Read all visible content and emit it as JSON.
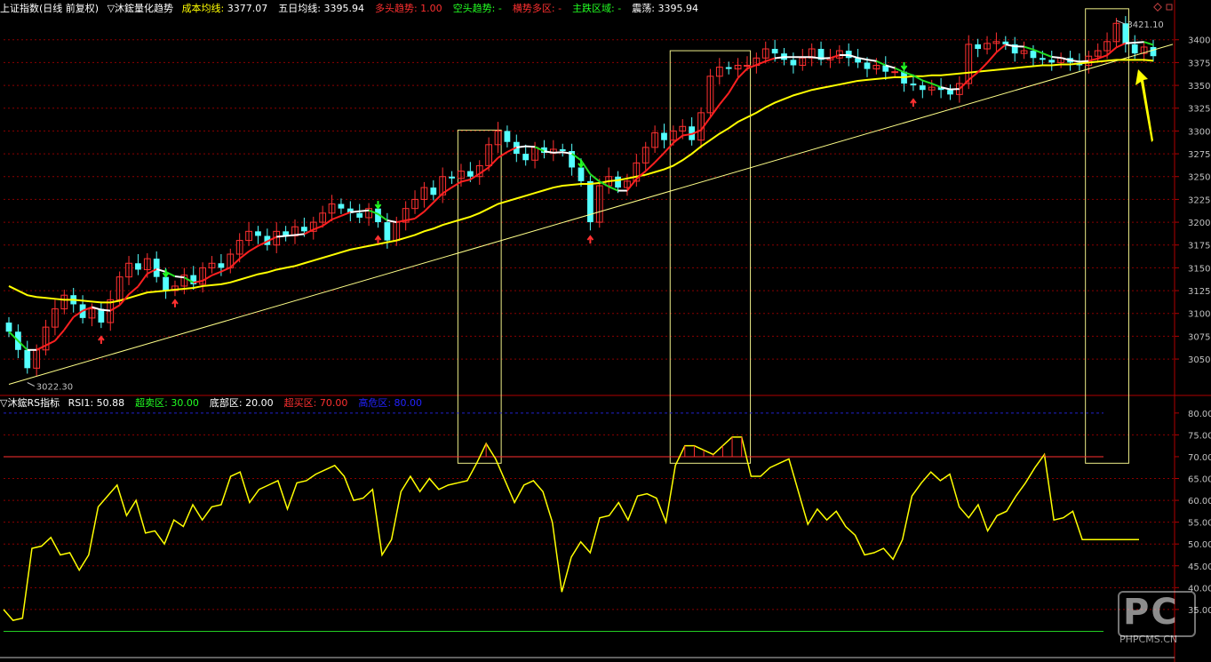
{
  "header": {
    "title": "上证指数(日线 前复权)",
    "indicator_name": "▽沐鋐量化趋势",
    "items": [
      {
        "label": "成本均线:",
        "value": "3377.07",
        "color": "#ffff00"
      },
      {
        "label": "五日均线:",
        "value": "3395.94",
        "color": "#ffffff"
      },
      {
        "label": "多头趋势:",
        "value": "1.00",
        "color": "#ff3030"
      },
      {
        "label": "空头趋势:",
        "value": "-",
        "color": "#22ff22"
      },
      {
        "label": "横势多区:",
        "value": "-",
        "color": "#ff3030"
      },
      {
        "label": "主跌区域:",
        "value": "-",
        "color": "#22ff22"
      },
      {
        "label": "震荡:",
        "value": "3395.94",
        "color": "#ffffff"
      }
    ]
  },
  "rsi_header": {
    "name": "▽沐鋐RS指标",
    "items": [
      {
        "label": "RSI1:",
        "value": "50.88",
        "color": "#ffffff"
      },
      {
        "label": "超卖区:",
        "value": "30.00",
        "color": "#22ff22"
      },
      {
        "label": "底部区:",
        "value": "20.00",
        "color": "#ffffff"
      },
      {
        "label": "超买区:",
        "value": "70.00",
        "color": "#ff3030"
      },
      {
        "label": "高危区:",
        "value": "80.00",
        "color": "#2222ff"
      }
    ]
  },
  "annotations": {
    "high_label": "3421.10",
    "low_label": "3022.30"
  },
  "watermark": {
    "logo": "PC",
    "text": "PHPCMS.CN"
  },
  "colors": {
    "up": "#ff3030",
    "down": "#54ffff",
    "cost_ma": "#ffff00",
    "ma5": "#ffffff",
    "rsi": "#ffff00",
    "grid": "#8b0000",
    "axis_text": "#c0c0c0"
  },
  "chart_data": [
    {
      "type": "candlestick",
      "title": "上证指数(日线 前复权)",
      "y_ticks": [
        3050,
        3075,
        3100,
        3125,
        3150,
        3175,
        3200,
        3225,
        3250,
        3275,
        3300,
        3325,
        3350,
        3375,
        3400
      ],
      "ylim": [
        3015,
        3428
      ],
      "close": [
        3080,
        3060,
        3040,
        3060,
        3085,
        3105,
        3120,
        3110,
        3095,
        3105,
        3090,
        3115,
        3140,
        3155,
        3148,
        3160,
        3140,
        3125,
        3130,
        3142,
        3132,
        3150,
        3155,
        3150,
        3165,
        3180,
        3190,
        3185,
        3175,
        3190,
        3185,
        3195,
        3190,
        3200,
        3210,
        3220,
        3215,
        3210,
        3205,
        3215,
        3200,
        3180,
        3200,
        3215,
        3225,
        3238,
        3230,
        3250,
        3248,
        3256,
        3250,
        3262,
        3285,
        3300,
        3288,
        3275,
        3268,
        3282,
        3276,
        3280,
        3278,
        3260,
        3245,
        3200,
        3240,
        3250,
        3238,
        3245,
        3265,
        3282,
        3298,
        3290,
        3300,
        3305,
        3290,
        3320,
        3360,
        3370,
        3368,
        3372,
        3372,
        3380,
        3390,
        3385,
        3378,
        3372,
        3380,
        3390,
        3378,
        3380,
        3388,
        3380,
        3375,
        3368,
        3372,
        3365,
        3365,
        3352,
        3350,
        3345,
        3348,
        3345,
        3340,
        3352,
        3395,
        3390,
        3396,
        3398,
        3395,
        3385,
        3388,
        3380,
        3378,
        3375,
        3380,
        3375,
        3372,
        3382,
        3388,
        3398,
        3418,
        3395,
        3385,
        3392,
        3382
      ],
      "open_ma_note": "",
      "cost_ma": [
        3130,
        3125,
        3120,
        3118,
        3117,
        3116,
        3115,
        3115,
        3114,
        3113,
        3112,
        3112,
        3114,
        3117,
        3120,
        3123,
        3124,
        3125,
        3126,
        3127,
        3128,
        3130,
        3131,
        3132,
        3134,
        3137,
        3140,
        3143,
        3145,
        3148,
        3150,
        3152,
        3155,
        3158,
        3161,
        3164,
        3167,
        3170,
        3172,
        3174,
        3176,
        3178,
        3180,
        3183,
        3186,
        3190,
        3193,
        3197,
        3200,
        3203,
        3206,
        3210,
        3215,
        3220,
        3223,
        3226,
        3229,
        3232,
        3235,
        3238,
        3240,
        3241,
        3242,
        3242,
        3243,
        3245,
        3246,
        3248,
        3250,
        3252,
        3255,
        3258,
        3262,
        3268,
        3275,
        3283,
        3290,
        3297,
        3303,
        3310,
        3315,
        3320,
        3326,
        3331,
        3335,
        3339,
        3342,
        3345,
        3347,
        3349,
        3351,
        3353,
        3355,
        3356,
        3357,
        3358,
        3359,
        3359,
        3360,
        3360,
        3361,
        3361,
        3362,
        3363,
        3364,
        3365,
        3366,
        3367,
        3368,
        3369,
        3370,
        3371,
        3372,
        3372,
        3373,
        3373,
        3374,
        3375,
        3376,
        3377,
        3378,
        3378,
        3378,
        3378,
        3377
      ],
      "trend_line": {
        "from": [
          0,
          3022.3
        ],
        "to": [
          125,
          3392
        ]
      }
    },
    {
      "type": "line",
      "title": "▽沐鋐RS指标",
      "y_ticks": [
        35,
        40,
        45,
        50,
        55,
        60,
        65,
        70,
        75,
        80
      ],
      "ylim": [
        25,
        82
      ],
      "overbought": 70,
      "oversold": 30,
      "danger": 80,
      "values": [
        35,
        32.5,
        33,
        49,
        49.5,
        51.5,
        47.5,
        48,
        44,
        47.5,
        58.5,
        61,
        63.5,
        56.5,
        60,
        52.5,
        53,
        50,
        55.5,
        54,
        59,
        55.5,
        58.5,
        59,
        65.5,
        66.5,
        59.5,
        62.5,
        63.5,
        64.5,
        58,
        64,
        64.5,
        66,
        67,
        68,
        65.5,
        60,
        60.5,
        62.5,
        47.5,
        51,
        62,
        65.5,
        62,
        65,
        62.5,
        63.5,
        64,
        64.5,
        68.5,
        73,
        69.5,
        64.5,
        59.5,
        63.5,
        64.5,
        62,
        55,
        39,
        47,
        50.5,
        48,
        56,
        56.5,
        59.5,
        55.5,
        61,
        61.5,
        60.5,
        55,
        68,
        72.5,
        72.5,
        71.5,
        70.5,
        72.5,
        74.5,
        74.5,
        65.5,
        65.5,
        67.5,
        68.5,
        69.5,
        62,
        54.5,
        58,
        55.5,
        57.5,
        54,
        52,
        47.5,
        48,
        49,
        46.5,
        51,
        61,
        64,
        66.5,
        64.5,
        66,
        58.5,
        56,
        59,
        53,
        56.5,
        57.5,
        61,
        64,
        67.5,
        70.5,
        55.5,
        56,
        57.5,
        51,
        51,
        51,
        51,
        51,
        51,
        51
      ]
    }
  ]
}
